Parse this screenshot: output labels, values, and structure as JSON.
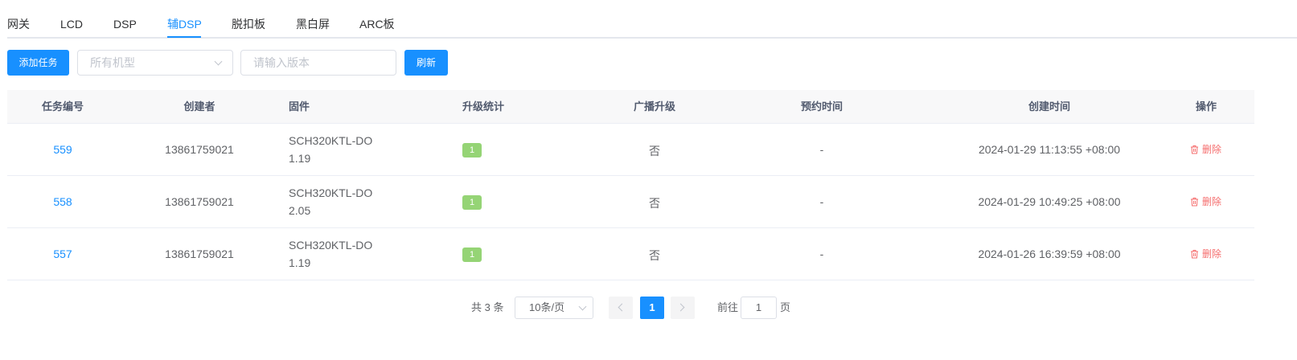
{
  "tabs": [
    {
      "label": "网关"
    },
    {
      "label": "LCD"
    },
    {
      "label": "DSP"
    },
    {
      "label": "辅DSP"
    },
    {
      "label": "脱扣板"
    },
    {
      "label": "黑白屏"
    },
    {
      "label": "ARC板"
    }
  ],
  "active_tab": "辅DSP",
  "toolbar": {
    "add_label": "添加任务",
    "model_placeholder": "所有机型",
    "version_placeholder": "请输入版本",
    "refresh_label": "刷新"
  },
  "table": {
    "headers": {
      "task_id": "任务编号",
      "creator": "创建者",
      "firmware": "固件",
      "stats": "升级统计",
      "broadcast": "广播升级",
      "scheduled": "预约时间",
      "created": "创建时间",
      "actions": "操作"
    },
    "rows": [
      {
        "task_id": "559",
        "creator": "13861759021",
        "firmware_name": "SCH320KTL-DO",
        "firmware_version": "1.19",
        "stats": "1",
        "broadcast": "否",
        "scheduled": "-",
        "created": "2024-01-29 11:13:55 +08:00",
        "action": "删除"
      },
      {
        "task_id": "558",
        "creator": "13861759021",
        "firmware_name": "SCH320KTL-DO",
        "firmware_version": "2.05",
        "stats": "1",
        "broadcast": "否",
        "scheduled": "-",
        "created": "2024-01-29 10:49:25 +08:00",
        "action": "删除"
      },
      {
        "task_id": "557",
        "creator": "13861759021",
        "firmware_name": "SCH320KTL-DO",
        "firmware_version": "1.19",
        "stats": "1",
        "broadcast": "否",
        "scheduled": "-",
        "created": "2024-01-26 16:39:59 +08:00",
        "action": "删除"
      }
    ]
  },
  "pagination": {
    "total_text": "共 3 条",
    "page_size": "10条/页",
    "current_page": "1",
    "goto_label": "前往",
    "goto_value": "1",
    "page_suffix": "页"
  },
  "colors": {
    "primary": "#1890ff",
    "success_badge": "#95d475",
    "danger": "#f56c6c"
  }
}
